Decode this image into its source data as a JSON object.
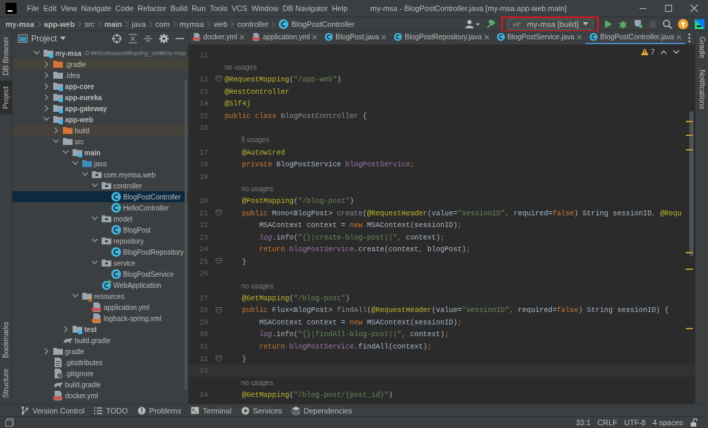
{
  "window": {
    "title": "my-msa - BlogPostController.java [my-msa.app-web.main]"
  },
  "menu": [
    "File",
    "Edit",
    "View",
    "Navigate",
    "Code",
    "Refactor",
    "Build",
    "Run",
    "Tools",
    "VCS",
    "Window",
    "DB Navigator",
    "Help"
  ],
  "breadcrumbs": [
    {
      "label": "my-msa",
      "kind": "module"
    },
    {
      "label": "app-web",
      "kind": "module"
    },
    {
      "label": "src",
      "kind": "folder"
    },
    {
      "label": "main",
      "kind": "module"
    },
    {
      "label": "java",
      "kind": "folder"
    },
    {
      "label": "com",
      "kind": "folder"
    },
    {
      "label": "mymsa",
      "kind": "folder"
    },
    {
      "label": "web",
      "kind": "folder"
    },
    {
      "label": "controller",
      "kind": "folder"
    },
    {
      "label": "BlogPostController",
      "kind": "class"
    }
  ],
  "toolbar": {
    "run_config": {
      "label": "my-msa [build]",
      "highlighted": true
    },
    "buttons": [
      {
        "kind": "user"
      },
      {
        "kind": "build"
      },
      {
        "kind": "run-config"
      },
      {
        "kind": "run",
        "disabled": false
      },
      {
        "kind": "debug",
        "disabled": false
      },
      {
        "kind": "coverage",
        "disabled": false
      },
      {
        "kind": "stop",
        "disabled": true
      },
      {
        "kind": "search"
      },
      {
        "kind": "update"
      },
      {
        "kind": "toolbox"
      }
    ]
  },
  "left_strip": {
    "top": [
      {
        "label": "DB Browser",
        "selected": false
      },
      {
        "label": "Project",
        "selected": true
      }
    ],
    "bottom": [
      {
        "label": "Bookmarks",
        "selected": false
      },
      {
        "label": "Structure",
        "selected": false
      }
    ]
  },
  "right_strip": [
    {
      "label": "Gradle",
      "selected": false
    },
    {
      "label": "Notifications",
      "selected": false
    }
  ],
  "project_panel": {
    "title": "Project",
    "tree": [
      {
        "label": "my-msa",
        "kind": "module",
        "path": "D:₩Workspace₩spring_ws₩my-msa",
        "selected": false,
        "expanded": true,
        "children": [
          {
            "label": ".gradle",
            "kind": "excluded-folder",
            "selected": false,
            "expanded": false
          },
          {
            "label": ".idea",
            "kind": "folder",
            "selected": false,
            "expanded": false
          },
          {
            "label": "app-core",
            "kind": "module",
            "selected": false,
            "expanded": false
          },
          {
            "label": "app-eureka",
            "kind": "module",
            "selected": false,
            "expanded": false
          },
          {
            "label": "app-gateway",
            "kind": "module",
            "selected": false,
            "expanded": false
          },
          {
            "label": "app-web",
            "kind": "module",
            "selected": false,
            "expanded": true,
            "children": [
              {
                "label": "build",
                "kind": "excluded-folder",
                "selected": false,
                "expanded": false
              },
              {
                "label": "src",
                "kind": "folder",
                "selected": false,
                "expanded": true,
                "children": [
                  {
                    "label": "main",
                    "kind": "module",
                    "selected": false,
                    "expanded": true,
                    "children": [
                      {
                        "label": "java",
                        "kind": "source-folder",
                        "selected": false,
                        "expanded": true,
                        "children": [
                          {
                            "label": "com.mymsa.web",
                            "kind": "package",
                            "selected": false,
                            "expanded": true,
                            "children": [
                              {
                                "label": "controller",
                                "kind": "package",
                                "selected": false,
                                "expanded": true,
                                "children": [
                                  {
                                    "label": "BlogPostController",
                                    "kind": "class",
                                    "selected": true
                                  },
                                  {
                                    "label": "HelloController",
                                    "kind": "class",
                                    "selected": false
                                  }
                                ]
                              },
                              {
                                "label": "model",
                                "kind": "package",
                                "selected": false,
                                "expanded": true,
                                "children": [
                                  {
                                    "label": "BlogPost",
                                    "kind": "class",
                                    "selected": false
                                  }
                                ]
                              },
                              {
                                "label": "repository",
                                "kind": "package",
                                "selected": false,
                                "expanded": true,
                                "children": [
                                  {
                                    "label": "BlogPostRepository",
                                    "kind": "class",
                                    "selected": false
                                  }
                                ]
                              },
                              {
                                "label": "service",
                                "kind": "package",
                                "selected": false,
                                "expanded": true,
                                "children": [
                                  {
                                    "label": "BlogPostService",
                                    "kind": "class",
                                    "selected": false
                                  }
                                ]
                              },
                              {
                                "label": "WebApplication",
                                "kind": "main-class",
                                "selected": false
                              }
                            ]
                          }
                        ]
                      },
                      {
                        "label": "resources",
                        "kind": "resources",
                        "selected": false,
                        "expanded": true,
                        "children": [
                          {
                            "label": "application.yml",
                            "kind": "yml",
                            "selected": false
                          },
                          {
                            "label": "logback-spring.xml",
                            "kind": "xml",
                            "selected": false
                          }
                        ]
                      }
                    ]
                  },
                  {
                    "label": "test",
                    "kind": "module",
                    "selected": false,
                    "expanded": false
                  }
                ]
              },
              {
                "label": "build.gradle",
                "kind": "gradle",
                "selected": false
              }
            ]
          },
          {
            "label": "gradle",
            "kind": "folder",
            "selected": false,
            "expanded": false
          },
          {
            "label": ".gitattributes",
            "kind": "text-file",
            "selected": false
          },
          {
            "label": ".gitignore",
            "kind": "ignore-file",
            "selected": false
          },
          {
            "label": "build.gradle",
            "kind": "gradle",
            "selected": false
          },
          {
            "label": "docker.yml",
            "kind": "yml",
            "selected": false
          }
        ]
      }
    ]
  },
  "editor": {
    "tabs": [
      {
        "label": "docker.yml",
        "kind": "yml",
        "selected": false
      },
      {
        "label": "application.yml",
        "kind": "yml",
        "selected": false
      },
      {
        "label": "BlogPost.java",
        "kind": "class",
        "selected": false
      },
      {
        "label": "BlogPostRepository.java",
        "kind": "class",
        "selected": false
      },
      {
        "label": "BlogPostService.java",
        "kind": "class",
        "selected": false
      },
      {
        "label": "BlogPostController.java",
        "kind": "class",
        "selected": true
      }
    ],
    "warnings": "7",
    "lines": [
      {
        "kind": "code",
        "number": "11"
      },
      {
        "kind": "hint",
        "text": "no usages"
      },
      {
        "kind": "code",
        "number": "12",
        "fold": true,
        "tokens": [
          {
            "kind": "ann",
            "text": "@RequestMapping"
          },
          {
            "kind": "plain",
            "text": "("
          },
          {
            "kind": "str",
            "text": "\"/app-web\""
          },
          {
            "kind": "plain",
            "text": ")"
          }
        ]
      },
      {
        "kind": "code",
        "number": "13",
        "tokens": [
          {
            "kind": "ann",
            "text": "@RestController"
          }
        ]
      },
      {
        "kind": "code",
        "number": "14",
        "tokens": [
          {
            "kind": "ann",
            "text": "@Slf4j"
          }
        ]
      },
      {
        "kind": "code",
        "number": "15",
        "tokens": [
          {
            "kind": "kw",
            "text": "public class "
          },
          {
            "kind": "dim",
            "text": "BlogPostController"
          },
          {
            "kind": "plain",
            "text": " {"
          }
        ]
      },
      {
        "kind": "code",
        "number": "16"
      },
      {
        "kind": "hint",
        "text": "5 usages"
      },
      {
        "kind": "code",
        "number": "17",
        "tokens": [
          {
            "kind": "ann",
            "text": "    @Autowired"
          }
        ]
      },
      {
        "kind": "code",
        "number": "18",
        "tokens": [
          {
            "kind": "kw",
            "text": "    private "
          },
          {
            "kind": "plain",
            "text": "BlogPostService "
          },
          {
            "kind": "field",
            "text": "blogPostService"
          },
          {
            "kind": "kw",
            "text": ";"
          }
        ]
      },
      {
        "kind": "code",
        "number": "19"
      },
      {
        "kind": "hint",
        "text": "no usages"
      },
      {
        "kind": "code",
        "number": "20",
        "tokens": [
          {
            "kind": "ann",
            "text": "    @PostMapping"
          },
          {
            "kind": "plain",
            "text": "("
          },
          {
            "kind": "str",
            "text": "\"/blog-post\""
          },
          {
            "kind": "plain",
            "text": ")"
          }
        ]
      },
      {
        "kind": "code",
        "number": "21",
        "fold": true,
        "tokens": [
          {
            "kind": "kw",
            "text": "    public "
          },
          {
            "kind": "plain",
            "text": "Mono<BlogPost> "
          },
          {
            "kind": "dim",
            "text": "create"
          },
          {
            "kind": "plain",
            "text": "("
          },
          {
            "kind": "ann",
            "text": "@RequestHeader"
          },
          {
            "kind": "plain",
            "text": "(value="
          },
          {
            "kind": "str",
            "text": "\"sessionID\""
          },
          {
            "kind": "kw",
            "text": ", "
          },
          {
            "kind": "plain",
            "text": "required="
          },
          {
            "kind": "kw",
            "text": "false"
          },
          {
            "kind": "plain",
            "text": ") String sessionID"
          },
          {
            "kind": "kw",
            "text": ", "
          },
          {
            "kind": "ann",
            "text": "@Requ"
          }
        ]
      },
      {
        "kind": "code",
        "number": "22",
        "tokens": [
          {
            "kind": "plain",
            "text": "        MSAContext context = "
          },
          {
            "kind": "kw",
            "text": "new "
          },
          {
            "kind": "plain",
            "text": "MSAContext(sessionID)"
          },
          {
            "kind": "kw",
            "text": ";"
          }
        ]
      },
      {
        "kind": "code",
        "number": "23",
        "tokens": [
          {
            "kind": "log",
            "text": "        log"
          },
          {
            "kind": "plain",
            "text": ".info("
          },
          {
            "kind": "str",
            "text": "\"{}|create-blog-post||\""
          },
          {
            "kind": "kw",
            "text": ", "
          },
          {
            "kind": "plain",
            "text": "context)"
          },
          {
            "kind": "kw",
            "text": ";"
          }
        ]
      },
      {
        "kind": "code",
        "number": "24",
        "tokens": [
          {
            "kind": "kw",
            "text": "        return "
          },
          {
            "kind": "field",
            "text": "blogPostService"
          },
          {
            "kind": "plain",
            "text": ".create(context"
          },
          {
            "kind": "kw",
            "text": ", "
          },
          {
            "kind": "plain",
            "text": "blogPost)"
          },
          {
            "kind": "kw",
            "text": ";"
          }
        ]
      },
      {
        "kind": "code",
        "number": "25",
        "fold": true,
        "tokens": [
          {
            "kind": "plain",
            "text": "    }"
          }
        ]
      },
      {
        "kind": "code",
        "number": "26"
      },
      {
        "kind": "hint",
        "text": "no usages"
      },
      {
        "kind": "code",
        "number": "27",
        "tokens": [
          {
            "kind": "ann",
            "text": "    @GetMapping"
          },
          {
            "kind": "plain",
            "text": "("
          },
          {
            "kind": "str",
            "text": "\"/blog-post\""
          },
          {
            "kind": "plain",
            "text": ")"
          }
        ]
      },
      {
        "kind": "code",
        "number": "28",
        "fold": true,
        "tokens": [
          {
            "kind": "kw",
            "text": "    public "
          },
          {
            "kind": "plain",
            "text": "Flux<BlogPost> "
          },
          {
            "kind": "dim",
            "text": "findAll"
          },
          {
            "kind": "plain",
            "text": "("
          },
          {
            "kind": "ann",
            "text": "@RequestHeader"
          },
          {
            "kind": "plain",
            "text": "(value="
          },
          {
            "kind": "str",
            "text": "\"sessionID\""
          },
          {
            "kind": "kw",
            "text": ", "
          },
          {
            "kind": "plain",
            "text": "required="
          },
          {
            "kind": "kw",
            "text": "false"
          },
          {
            "kind": "plain",
            "text": ") String sessionID) {"
          }
        ]
      },
      {
        "kind": "code",
        "number": "29",
        "tokens": [
          {
            "kind": "plain",
            "text": "        MSAContext context = "
          },
          {
            "kind": "kw",
            "text": "new "
          },
          {
            "kind": "plain",
            "text": "MSAContext(sessionID)"
          },
          {
            "kind": "kw",
            "text": ";"
          }
        ]
      },
      {
        "kind": "code",
        "number": "30",
        "tokens": [
          {
            "kind": "log",
            "text": "        log"
          },
          {
            "kind": "plain",
            "text": ".info("
          },
          {
            "kind": "str",
            "text": "\"{}|findAll-blog-post||\""
          },
          {
            "kind": "kw",
            "text": ", "
          },
          {
            "kind": "plain",
            "text": "context)"
          },
          {
            "kind": "kw",
            "text": ";"
          }
        ]
      },
      {
        "kind": "code",
        "number": "31",
        "tokens": [
          {
            "kind": "kw",
            "text": "        return "
          },
          {
            "kind": "field",
            "text": "blogPostService"
          },
          {
            "kind": "plain",
            "text": ".findAll(context)"
          },
          {
            "kind": "kw",
            "text": ";"
          }
        ]
      },
      {
        "kind": "code",
        "number": "32",
        "fold": true,
        "tokens": [
          {
            "kind": "plain",
            "text": "    }"
          }
        ]
      },
      {
        "kind": "code",
        "number": "33",
        "current": true
      },
      {
        "kind": "hint",
        "text": "no usages"
      },
      {
        "kind": "code",
        "number": "34",
        "tokens": [
          {
            "kind": "ann",
            "text": "    @GetMapping"
          },
          {
            "kind": "plain",
            "text": "("
          },
          {
            "kind": "str",
            "text": "\"/blog-post/{post_id}\""
          },
          {
            "kind": "plain",
            "text": ")"
          }
        ]
      }
    ]
  },
  "tool_windows": [
    {
      "label": "Version Control",
      "kind": "branch"
    },
    {
      "label": "TODO",
      "kind": "list"
    },
    {
      "label": "Problems",
      "kind": "problem"
    },
    {
      "label": "Terminal",
      "kind": "terminal"
    },
    {
      "label": "Services",
      "kind": "services"
    },
    {
      "label": "Dependencies",
      "kind": "stack"
    }
  ],
  "status_bar": [
    "33:1",
    "CRLF",
    "UTF-8",
    "4 spaces"
  ]
}
